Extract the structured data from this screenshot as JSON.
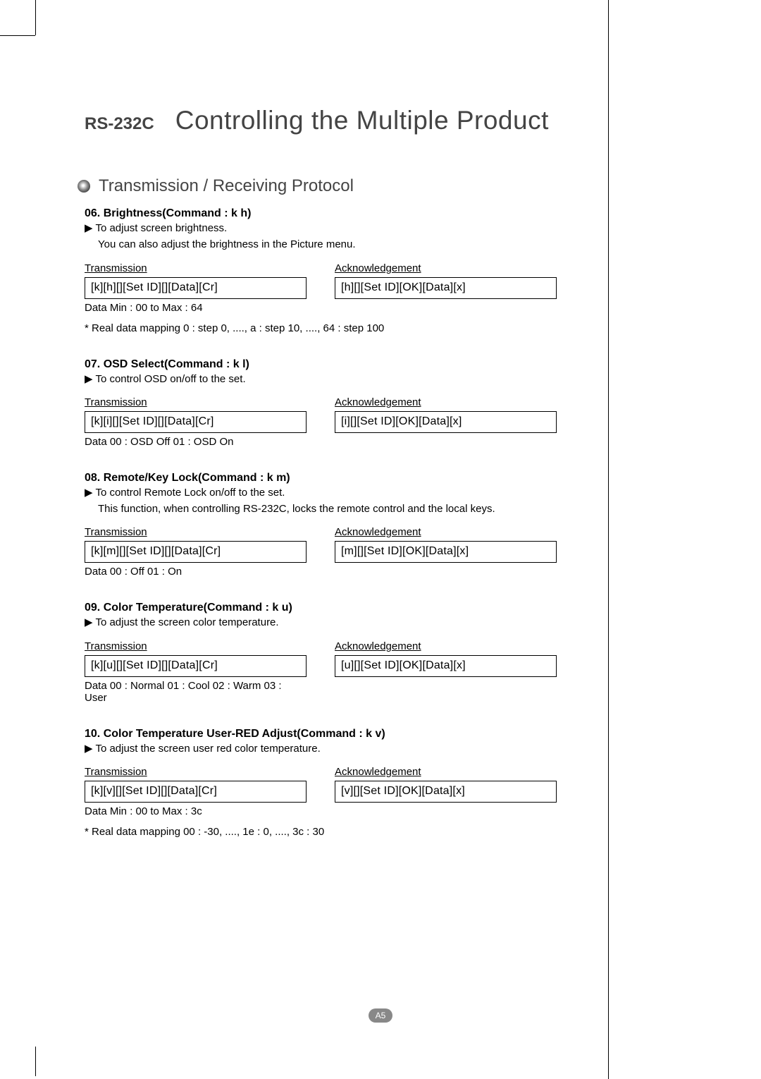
{
  "header": {
    "tag": "RS-232C",
    "title": "Controlling the Multiple Product"
  },
  "section_title": "Transmission / Receiving Protocol",
  "labels": {
    "transmission": "Transmission",
    "acknowledgement": "Acknowledgement"
  },
  "commands": [
    {
      "title": "06. Brightness(Command : k h)",
      "desc1": "To adjust screen brightness.",
      "desc2": "You can also adjust the brightness in the Picture menu.",
      "tx": "[k][h][][Set ID][][Data][Cr]",
      "ack": "[h][][Set ID][OK][Data][x]",
      "dataline": "Data Min : 00 to Max : 64",
      "note": "* Real data mapping 0 : step 0, ...., a : step 10, ...., 64 : step 100"
    },
    {
      "title": "07. OSD Select(Command : k l)",
      "desc1": "To control OSD on/off to the set.",
      "desc2": "",
      "tx": "[k][i][][Set ID][][Data][Cr]",
      "ack": "[i][][Set ID][OK][Data][x]",
      "dataline": "Data 00 : OSD Off    01 : OSD On",
      "note": ""
    },
    {
      "title": "08. Remote/Key Lock(Command : k m)",
      "desc1": "To control Remote Lock on/off to the set.",
      "desc2": "This function, when controlling RS-232C, locks the remote control and the local keys.",
      "tx": "[k][m][][Set ID][][Data][Cr]",
      "ack": "[m][][Set ID][OK][Data][x]",
      "dataline": "Data 00 : Off    01 : On",
      "note": ""
    },
    {
      "title": "09. Color Temperature(Command : k u)",
      "desc1": "To adjust the screen color temperature.",
      "desc2": "",
      "tx": "[k][u][][Set ID][][Data][Cr]",
      "ack": "[u][][Set ID][OK][Data][x]",
      "dataline": "Data 00 : Normal    01 : Cool    02 : Warm    03 : User",
      "note": ""
    },
    {
      "title": "10. Color Temperature User-RED Adjust(Command : k v)",
      "desc1": "To adjust the screen user red color temperature.",
      "desc2": "",
      "tx": "[k][v][][Set ID][][Data][Cr]",
      "ack": "[v][][Set ID][OK][Data][x]",
      "dataline": "Data Min : 00 to Max : 3c",
      "note": "* Real data mapping 00 : -30, ...., 1e : 0, ...., 3c : 30"
    }
  ],
  "page_number": "A5"
}
